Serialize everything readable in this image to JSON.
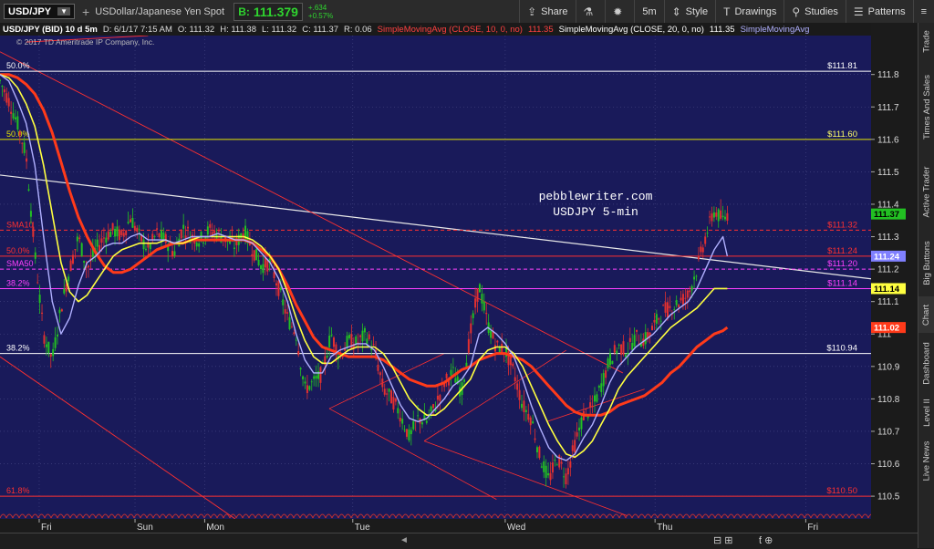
{
  "toolbar": {
    "symbol": "USD/JPY",
    "description": "USDollar/Japanese Yen Spot",
    "bid_label": "B:",
    "bid_value": "111.379",
    "change_abs": "+.634",
    "change_pct": "+0.57%",
    "buttons": [
      {
        "label": "Share",
        "icon": "share-icon"
      },
      {
        "label": "",
        "icon": "flask-icon"
      },
      {
        "label": "",
        "icon": "gear-icon"
      },
      {
        "label": "5m",
        "icon": ""
      },
      {
        "label": "Style",
        "icon": "style-icon"
      },
      {
        "label": "Drawings",
        "icon": "drawings-icon"
      },
      {
        "label": "Studies",
        "icon": "studies-icon"
      },
      {
        "label": "Patterns",
        "icon": "patterns-icon"
      }
    ]
  },
  "info_bar": {
    "title": "USD/JPY (BID) 10 d 5m",
    "date": "D: 6/1/17 7:15 AM",
    "open": "O: 111.32",
    "high": "H: 111.38",
    "low": "L: 111.32",
    "close": "C: 111.37",
    "range": "R: 0.06",
    "sma10_label": "SimpleMovingAvg (CLOSE, 10, 0, no)",
    "sma10_value": "111.35",
    "sma20_label": "SimpleMovingAvg (CLOSE, 20, 0, no)",
    "sma20_value": "111.35",
    "sma50_label": "SimpleMovingAvg"
  },
  "copyright": "© 2017 TD Ameritrade IP Company, Inc.",
  "watermark": {
    "line1": "pebblewriter.com",
    "line2": "USDJPY 5-min"
  },
  "colors": {
    "plot_bg": "#191a5a",
    "up_candle": "#22c022",
    "down_candle": "#e23030",
    "sma10": "#b0b0ff",
    "sma20": "#ffff40",
    "sma50": "#ff3a1a",
    "trendline": "#ff3030",
    "white_line": "#e8e8e8",
    "fib_yellow": "#e6e600",
    "fib_red": "#ff3030",
    "fib_magenta": "#ff40ff",
    "grid": "#4a4a88"
  },
  "fib_levels": [
    {
      "left_label": "50.0%",
      "value": 111.81,
      "right_label": "$111.81",
      "color": "#ffffff"
    },
    {
      "left_label": "50.0%",
      "value": 111.6,
      "right_label": "$111.60",
      "color": "#e6e600"
    },
    {
      "left_label": "SMA10",
      "value": 111.32,
      "right_label": "$111.32",
      "color": "#ff3030",
      "dashed": true
    },
    {
      "left_label": "50.0%",
      "value": 111.24,
      "right_label": "$111.24",
      "color": "#ff3030"
    },
    {
      "left_label": "SMA50",
      "value": 111.2,
      "right_label": "$111.20",
      "color": "#ff40ff",
      "dashed": true
    },
    {
      "left_label": "38.2%",
      "value": 111.14,
      "right_label": "$111.14",
      "color": "#ff40ff"
    },
    {
      "left_label": "38.2%",
      "value": 110.94,
      "right_label": "$110.94",
      "color": "#ffffff"
    },
    {
      "left_label": "61.8%",
      "value": 110.5,
      "right_label": "$110.50",
      "color": "#ff3030"
    }
  ],
  "price_tags": [
    {
      "value": 111.37,
      "label": "111.37",
      "bg": "#22c022",
      "fg": "#000000"
    },
    {
      "value": 111.24,
      "label": "111.24",
      "bg": "#8080ff",
      "fg": "#ffffff"
    },
    {
      "value": 111.14,
      "label": "111.14",
      "bg": "#ffff40",
      "fg": "#000000"
    },
    {
      "value": 111.02,
      "label": "111.02",
      "bg": "#ff3a1a",
      "fg": "#ffffff"
    }
  ],
  "chart_data": {
    "type": "line",
    "title": "USD/JPY (BID) 10 d 5m",
    "xlabel": "",
    "ylabel": "",
    "ylim": [
      110.43,
      111.92
    ],
    "yticks": [
      110.5,
      110.6,
      110.7,
      110.8,
      110.9,
      111,
      111.1,
      111.2,
      111.3,
      111.4,
      111.5,
      111.6,
      111.7,
      111.8
    ],
    "ytick_labels": [
      "110.5",
      "110.6",
      "110.7",
      "110.8",
      "110.9",
      "111",
      "111.1",
      "111.2",
      "111.3",
      "111.4",
      "111.5",
      "111.6",
      "111.7",
      "111.8"
    ],
    "x_categories": [
      "Fri",
      "Sun",
      "Mon",
      "Tue",
      "Wed",
      "Thu",
      "Fri"
    ],
    "x_category_positions": [
      0.045,
      0.155,
      0.235,
      0.405,
      0.58,
      0.752,
      0.925
    ],
    "price_x": [
      0,
      0.01,
      0.02,
      0.03,
      0.04,
      0.05,
      0.06,
      0.07,
      0.08,
      0.09,
      0.1,
      0.11,
      0.12,
      0.13,
      0.14,
      0.15,
      0.16,
      0.17,
      0.18,
      0.19,
      0.2,
      0.21,
      0.22,
      0.23,
      0.24,
      0.25,
      0.26,
      0.27,
      0.28,
      0.29,
      0.3,
      0.31,
      0.32,
      0.33,
      0.34,
      0.35,
      0.36,
      0.37,
      0.38,
      0.39,
      0.4,
      0.41,
      0.42,
      0.43,
      0.44,
      0.45,
      0.46,
      0.47,
      0.48,
      0.49,
      0.5,
      0.51,
      0.52,
      0.53,
      0.54,
      0.55,
      0.56,
      0.57,
      0.58,
      0.59,
      0.6,
      0.61,
      0.62,
      0.63,
      0.64,
      0.65,
      0.66,
      0.67,
      0.68,
      0.69,
      0.7,
      0.71,
      0.72,
      0.73,
      0.74,
      0.75,
      0.76,
      0.77,
      0.78,
      0.79,
      0.8,
      0.81,
      0.82,
      0.83,
      0.835
    ],
    "series": [
      {
        "name": "USD/JPY",
        "values": [
          111.78,
          111.72,
          111.65,
          111.55,
          111.25,
          111.0,
          110.92,
          111.08,
          111.2,
          111.3,
          111.2,
          111.26,
          111.3,
          111.32,
          111.3,
          111.36,
          111.3,
          111.26,
          111.31,
          111.29,
          111.25,
          111.33,
          111.3,
          111.29,
          111.32,
          111.31,
          111.29,
          111.27,
          111.32,
          111.26,
          111.21,
          111.22,
          111.14,
          111.05,
          111.0,
          110.83,
          110.85,
          110.88,
          111.0,
          110.93,
          110.98,
          110.97,
          111.0,
          110.95,
          110.83,
          110.8,
          110.75,
          110.68,
          110.74,
          110.73,
          110.78,
          110.85,
          110.88,
          110.82,
          111.0,
          111.15,
          111.03,
          110.96,
          110.95,
          110.88,
          110.78,
          110.74,
          110.62,
          110.55,
          110.62,
          110.56,
          110.66,
          110.75,
          110.77,
          110.84,
          110.92,
          110.96,
          110.95,
          110.99,
          110.98,
          111.02,
          111.07,
          111.08,
          111.1,
          111.12,
          111.2,
          111.3,
          111.38,
          111.35,
          111.37
        ]
      },
      {
        "name": "SMA10",
        "values": [
          111.8,
          111.78,
          111.72,
          111.65,
          111.52,
          111.3,
          111.1,
          111.0,
          111.05,
          111.15,
          111.22,
          111.24,
          111.27,
          111.28,
          111.28,
          111.3,
          111.31,
          111.29,
          111.29,
          111.29,
          111.28,
          111.29,
          111.3,
          111.3,
          111.3,
          111.31,
          111.3,
          111.29,
          111.29,
          111.28,
          111.25,
          111.22,
          111.17,
          111.1,
          111.0,
          110.92,
          110.88,
          110.88,
          110.93,
          110.95,
          110.96,
          110.97,
          110.97,
          110.95,
          110.9,
          110.84,
          110.78,
          110.74,
          110.73,
          110.74,
          110.77,
          110.8,
          110.84,
          110.86,
          110.9,
          111.0,
          111.02,
          111.0,
          110.97,
          110.93,
          110.86,
          110.78,
          110.71,
          110.65,
          110.62,
          110.61,
          110.63,
          110.68,
          110.72,
          110.78,
          110.85,
          110.9,
          110.93,
          110.96,
          110.98,
          111.0,
          111.03,
          111.06,
          111.08,
          111.1,
          111.14,
          111.2,
          111.26,
          111.3,
          111.24
        ]
      },
      {
        "name": "SMA20",
        "values": [
          111.8,
          111.79,
          111.76,
          111.71,
          111.64,
          111.52,
          111.37,
          111.22,
          111.13,
          111.1,
          111.12,
          111.16,
          111.2,
          111.24,
          111.26,
          111.27,
          111.28,
          111.28,
          111.28,
          111.29,
          111.28,
          111.28,
          111.29,
          111.3,
          111.3,
          111.3,
          111.3,
          111.3,
          111.3,
          111.29,
          111.27,
          111.24,
          111.2,
          111.13,
          111.05,
          110.98,
          110.93,
          110.91,
          110.91,
          110.93,
          110.95,
          110.96,
          110.96,
          110.96,
          110.94,
          110.9,
          110.85,
          110.8,
          110.77,
          110.75,
          110.75,
          110.77,
          110.8,
          110.83,
          110.86,
          110.92,
          110.95,
          110.96,
          110.96,
          110.94,
          110.9,
          110.84,
          110.78,
          110.72,
          110.67,
          110.63,
          110.62,
          110.64,
          110.67,
          110.72,
          110.77,
          110.83,
          110.87,
          110.9,
          110.93,
          110.96,
          110.99,
          111.02,
          111.04,
          111.06,
          111.08,
          111.11,
          111.14,
          111.14,
          111.14
        ]
      },
      {
        "name": "SMA50",
        "values": [
          111.8,
          111.8,
          111.79,
          111.77,
          111.74,
          111.69,
          111.62,
          111.53,
          111.44,
          111.36,
          111.3,
          111.25,
          111.21,
          111.19,
          111.19,
          111.2,
          111.22,
          111.24,
          111.26,
          111.27,
          111.28,
          111.28,
          111.29,
          111.29,
          111.29,
          111.29,
          111.29,
          111.29,
          111.29,
          111.28,
          111.26,
          111.24,
          111.2,
          111.15,
          111.09,
          111.04,
          110.99,
          110.96,
          110.95,
          110.94,
          110.93,
          110.93,
          110.93,
          110.93,
          110.92,
          110.9,
          110.88,
          110.86,
          110.85,
          110.84,
          110.84,
          110.85,
          110.87,
          110.89,
          110.9,
          110.92,
          110.93,
          110.94,
          110.94,
          110.93,
          110.92,
          110.9,
          110.87,
          110.84,
          110.81,
          110.78,
          110.76,
          110.75,
          110.75,
          110.75,
          110.76,
          110.78,
          110.79,
          110.8,
          110.81,
          110.83,
          110.85,
          110.88,
          110.9,
          110.93,
          110.96,
          110.98,
          111.0,
          111.01,
          111.02
        ]
      }
    ]
  }
}
